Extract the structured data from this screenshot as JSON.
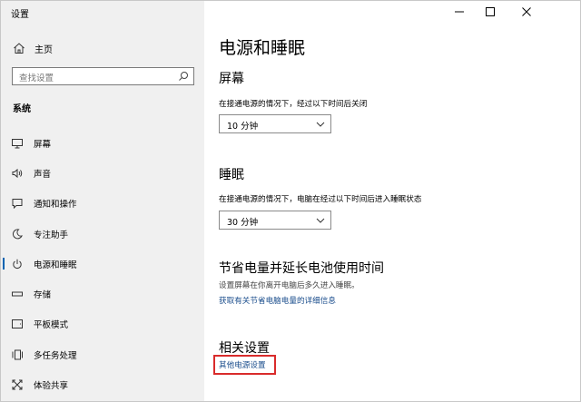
{
  "window": {
    "title": "设置"
  },
  "sidebar": {
    "home_label": "主页",
    "search_placeholder": "查找设置",
    "section_title": "系统",
    "items": [
      {
        "label": "屏幕",
        "icon": "monitor-icon"
      },
      {
        "label": "声音",
        "icon": "speaker-icon"
      },
      {
        "label": "通知和操作",
        "icon": "notification-icon"
      },
      {
        "label": "专注助手",
        "icon": "moon-icon"
      },
      {
        "label": "电源和睡眠",
        "icon": "power-icon",
        "active": true
      },
      {
        "label": "存储",
        "icon": "storage-icon"
      },
      {
        "label": "平板模式",
        "icon": "tablet-icon"
      },
      {
        "label": "多任务处理",
        "icon": "multitask-icon"
      },
      {
        "label": "体验共享",
        "icon": "share-icon"
      }
    ]
  },
  "titlebar": {
    "buttons": [
      "minimize-icon",
      "maximize-icon",
      "close-icon"
    ]
  },
  "main": {
    "title": "电源和睡眠",
    "screen": {
      "heading": "屏幕",
      "desc": "在接通电源的情况下，经过以下时间后关闭",
      "value": "10 分钟"
    },
    "sleep": {
      "heading": "睡眠",
      "desc": "在接通电源的情况下，电脑在经过以下时间后进入睡眠状态",
      "value": "30 分钟"
    },
    "battery": {
      "heading": "节省电量并延长电池使用时间",
      "desc": "设置屏幕在你离开电脑后多久进入睡眠。",
      "link": "获取有关节省电脑电量的详细信息"
    },
    "related": {
      "heading": "相关设置",
      "link": "其他电源设置"
    }
  },
  "colors": {
    "accent": "#0063b1",
    "link": "#1a4d8c",
    "highlight": "#d92b2b",
    "sidebar_bg": "#f0f0f0"
  }
}
